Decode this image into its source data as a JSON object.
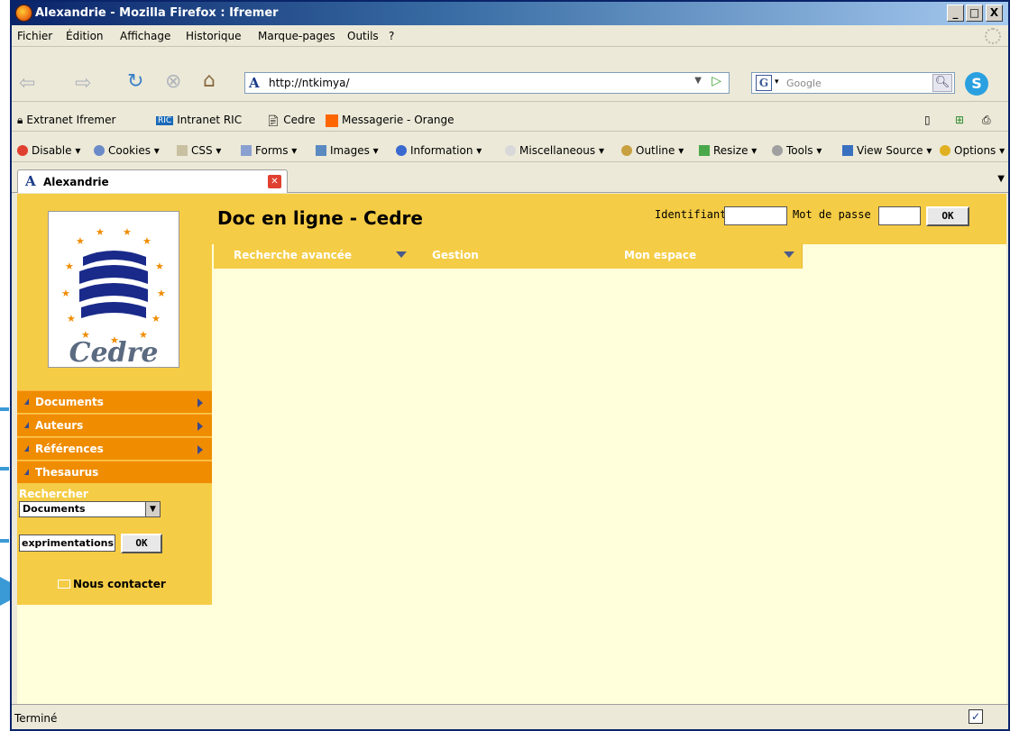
{
  "window": {
    "title": "Alexandrie - Mozilla Firefox : Ifremer",
    "min": "_",
    "max": "□",
    "close": "X"
  },
  "menu": [
    "Fichier",
    "Édition",
    "Affichage",
    "Historique",
    "Marque-pages",
    "Outils",
    "?"
  ],
  "nav": {
    "url": "http://ntkimya/",
    "search_placeholder": "Google"
  },
  "bookmarks": [
    "Extranet Ifremer",
    "Intranet RIC",
    "Cedre",
    "Messagerie - Orange"
  ],
  "devbar": [
    "Disable ▾",
    "Cookies ▾",
    "CSS ▾",
    "Forms ▾",
    "Images ▾",
    "Information ▾",
    "Miscellaneous ▾",
    "Outline ▾",
    "Resize ▾",
    "Tools ▾",
    "View Source ▾",
    "Options ▾"
  ],
  "tab": {
    "label": "Alexandrie"
  },
  "page": {
    "title": "Doc en ligne - Cedre",
    "login_label": "Identifiant",
    "password_label": "Mot de passe",
    "ok": "OK",
    "logo_text": "Cedre"
  },
  "topnav": [
    "Recherche avancée",
    "Gestion",
    "Mon espace"
  ],
  "sidebar": {
    "items": [
      "Documents",
      "Auteurs",
      "Références",
      "Thesaurus"
    ],
    "search_label": "Rechercher",
    "select_value": "Documents",
    "search_value": "exprimentations",
    "search_ok": "OK",
    "contact": "Nous contacter"
  },
  "status": "Terminé",
  "colors": {
    "header": "#f5cc45",
    "menu": "#f08c00",
    "content_bg": "#ffffdc",
    "callout": "#3a9ad6"
  }
}
